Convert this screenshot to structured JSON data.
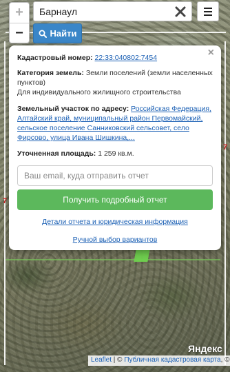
{
  "search": {
    "value": "Барнаул",
    "find_label": "Найти"
  },
  "zoom": {
    "in_label": "+",
    "out_label": "−"
  },
  "map": {
    "parcel_num_left": "7",
    "parcel_num_right": "7",
    "provider_logo": "Яндекс"
  },
  "popup": {
    "close_label": "×",
    "cadastral_label": "Кадастровый номер:",
    "cadastral_number": "22:33:040802:7454",
    "category_label": "Категория земель:",
    "category_value": "Земли поселений (земли населенных пунктов)",
    "usage": "Для индивидуального жилищного строительства",
    "address_label": "Земельный участок по адресу:",
    "address_value": "Российская Федерация, Алтайский край, муниципальный район Первомайский, сельское поселение Санниковский сельсовет, село Фирсово, улица Ивана Шишкина,...",
    "area_label": "Уточненная площадь:",
    "area_value": "1 259 кв.м.",
    "email_placeholder": "Ваш email, куда отправить отчет",
    "report_button": "Получить подробный отчет",
    "details_link": "Детали отчета и юридическая информация",
    "manual_link": "Ручной выбор вариантов"
  },
  "attribution": {
    "leaflet": "Leaflet",
    "separator": " | © ",
    "source": "Публичная кадастровая карта",
    "tail": ", ©"
  },
  "colors": {
    "find_button": "#3a86c8",
    "report_button": "#5cb85c",
    "link": "#1a5fb4"
  }
}
